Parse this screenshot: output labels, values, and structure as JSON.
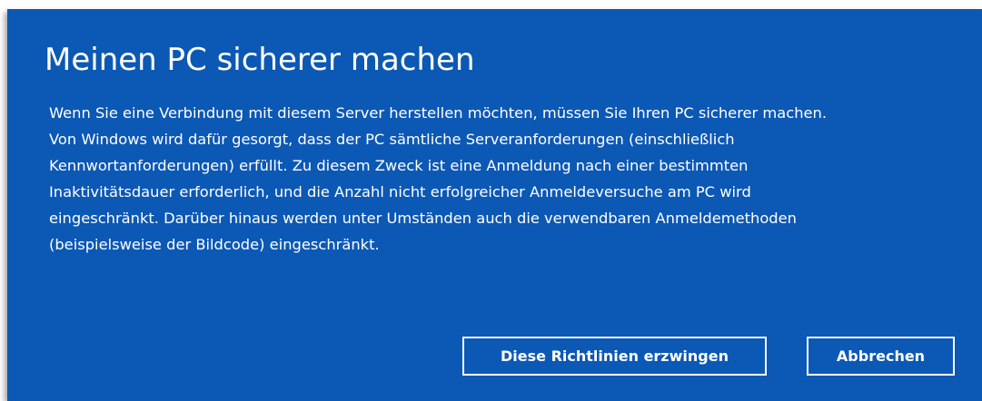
{
  "dialog": {
    "title": "Meinen PC sicherer machen",
    "message": "Wenn Sie eine Verbindung mit diesem Server herstellen möchten, müssen Sie Ihren PC sicherer machen. Von Windows wird dafür gesorgt, dass der PC sämtliche Serveranforderungen (einschließlich Kennwortanforderungen) erfüllt. Zu diesem Zweck ist eine Anmeldung nach einer bestimmten Inaktivitätsdauer erforderlich, und die Anzahl nicht erfolgreicher Anmeldeversuche am PC wird eingeschränkt. Darüber hinaus werden unter Umständen auch die verwendbaren Anmeldemethoden (beispielsweise der Bildcode) eingeschränkt.",
    "buttons": {
      "enforce_label": "Diese Richtlinien erzwingen",
      "cancel_label": "Abbrechen"
    }
  },
  "colors": {
    "dialog_background": "#0c58b5",
    "text": "#ffffff",
    "button_border": "#ffffff"
  }
}
